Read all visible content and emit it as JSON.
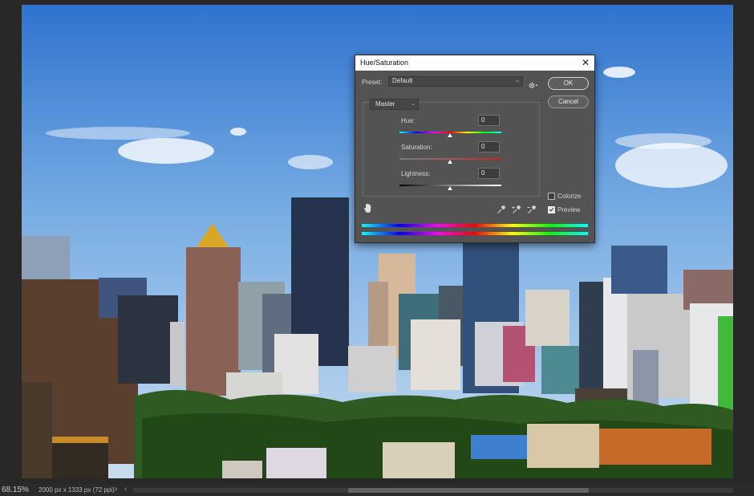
{
  "status_bar": {
    "zoom": "68.15%",
    "doc_info": "2000 px x 1333 px (72 ppi)",
    "arrow_right": "›",
    "arrow_left": "‹"
  },
  "dialog": {
    "title": "Hue/Saturation",
    "close_glyph": "✕",
    "preset_label": "Preset:",
    "preset_value": "Default",
    "ok_label": "OK",
    "cancel_label": "Cancel",
    "channel_value": "Master",
    "hue": {
      "label": "Hue:",
      "value": "0"
    },
    "saturation": {
      "label": "Saturation:",
      "value": "0"
    },
    "lightness": {
      "label": "Lightness:",
      "value": "0"
    },
    "colorize_label": "Colorize",
    "colorize_checked": false,
    "preview_label": "Preview",
    "preview_checked": true,
    "chevron_glyph": "⌄"
  },
  "icons": {
    "gear": "gear-icon",
    "close": "close-icon",
    "hand": "targeted-adjustment-hand-icon",
    "eyedropper": "eyedropper-icon",
    "eyedropper_add": "eyedropper-plus-icon",
    "eyedropper_subtract": "eyedropper-minus-icon"
  },
  "colors": {
    "dialog_bg": "#535353",
    "app_bg": "#282828",
    "sky": "#3f7fcf"
  }
}
